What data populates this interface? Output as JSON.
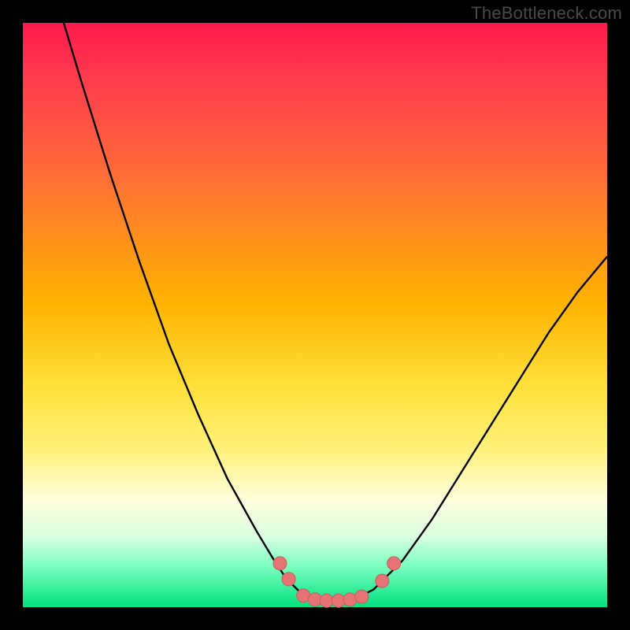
{
  "watermark": "TheBottleneck.com",
  "colors": {
    "frame": "#000000",
    "curve_stroke": "#000000",
    "marker_fill": "#e57373",
    "marker_stroke": "#cf5a5a"
  },
  "chart_data": {
    "type": "line",
    "title": "",
    "xlabel": "",
    "ylabel": "",
    "xlim": [
      0,
      100
    ],
    "ylim": [
      0,
      100
    ],
    "gradient": [
      {
        "pos": 0,
        "color": "#ff1a4d"
      },
      {
        "pos": 10,
        "color": "#ff3d4d"
      },
      {
        "pos": 25,
        "color": "#ff6a3a"
      },
      {
        "pos": 48,
        "color": "#ffb300"
      },
      {
        "pos": 62,
        "color": "#ffe03a"
      },
      {
        "pos": 73,
        "color": "#fff27a"
      },
      {
        "pos": 82,
        "color": "#fffde0"
      },
      {
        "pos": 88,
        "color": "#d8ffe0"
      },
      {
        "pos": 93,
        "color": "#7affc0"
      },
      {
        "pos": 100,
        "color": "#00e07f"
      }
    ],
    "curve": [
      {
        "x": 7,
        "y": 100
      },
      {
        "x": 10,
        "y": 90
      },
      {
        "x": 15,
        "y": 74
      },
      {
        "x": 20,
        "y": 59
      },
      {
        "x": 25,
        "y": 45
      },
      {
        "x": 30,
        "y": 33
      },
      {
        "x": 35,
        "y": 22
      },
      {
        "x": 40,
        "y": 13
      },
      {
        "x": 43,
        "y": 8
      },
      {
        "x": 45,
        "y": 5
      },
      {
        "x": 48,
        "y": 2
      },
      {
        "x": 50,
        "y": 1
      },
      {
        "x": 52,
        "y": 1
      },
      {
        "x": 55,
        "y": 1
      },
      {
        "x": 58,
        "y": 2
      },
      {
        "x": 60,
        "y": 3
      },
      {
        "x": 62,
        "y": 5
      },
      {
        "x": 65,
        "y": 8
      },
      {
        "x": 70,
        "y": 15
      },
      {
        "x": 75,
        "y": 23
      },
      {
        "x": 80,
        "y": 31
      },
      {
        "x": 85,
        "y": 39
      },
      {
        "x": 90,
        "y": 47
      },
      {
        "x": 95,
        "y": 54
      },
      {
        "x": 100,
        "y": 60
      }
    ],
    "markers": [
      {
        "x": 44.0,
        "y": 7.5
      },
      {
        "x": 45.5,
        "y": 4.8
      },
      {
        "x": 48.0,
        "y": 2.0
      },
      {
        "x": 50.0,
        "y": 1.3
      },
      {
        "x": 52.0,
        "y": 1.1
      },
      {
        "x": 54.0,
        "y": 1.1
      },
      {
        "x": 56.0,
        "y": 1.3
      },
      {
        "x": 58.0,
        "y": 1.8
      },
      {
        "x": 61.5,
        "y": 4.5
      },
      {
        "x": 63.5,
        "y": 7.5
      }
    ],
    "marker_radius_px": 8.5
  }
}
